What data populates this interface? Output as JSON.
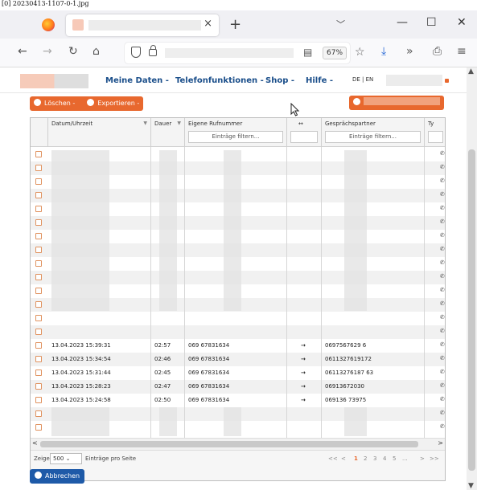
{
  "caption": "[0] 20230413-1107-0-1.jpg",
  "browser": {
    "tab_close": "×",
    "new_tab": "+",
    "tab_menu": "﹀",
    "win_min": "—",
    "win_max": "☐",
    "win_close": "✕",
    "nav_back": "←",
    "nav_forward": "→",
    "nav_reload": "↻",
    "nav_home": "⌂",
    "zoom": "67%",
    "toolbar_star": "☆",
    "toolbar_download": "⤓",
    "toolbar_more": "»",
    "toolbar_extensions": "⎙",
    "toolbar_menu": "≡"
  },
  "site": {
    "menu": [
      "Meine Daten -",
      "Telefonfunktionen -",
      "Shop -",
      "Hilfe -"
    ],
    "lang": "DE | EN",
    "actions": {
      "delete_label": "Löschen -",
      "export_label": "Exportieren -"
    }
  },
  "grid": {
    "columns": [
      "Datum/Uhrzeit",
      "Dauer",
      "Eigene Rufnummer",
      "↔",
      "Gesprächspartner",
      "Ty"
    ],
    "filter_placeholder": "Einträge filtern...",
    "rows": [
      {
        "datetime": "13.04.2023 15:39:31",
        "duration": "02:57",
        "own": "069 67831634",
        "partner": "0697567629 6"
      },
      {
        "datetime": "13.04.2023 15:34:54",
        "duration": "02:46",
        "own": "069 67831634",
        "partner": "0611327619172"
      },
      {
        "datetime": "13.04.2023 15:31:44",
        "duration": "02:45",
        "own": "069 67831634",
        "partner": "06113276187 63"
      },
      {
        "datetime": "13.04.2023 15:28:23",
        "duration": "02:47",
        "own": "069 67831634",
        "partner": "06913672030"
      },
      {
        "datetime": "13.04.2023 15:24:58",
        "duration": "02:50",
        "own": "069 67831634",
        "partner": "069136 73975"
      }
    ],
    "direction_glyph": "→",
    "type_glyph": "✆",
    "scroll_left": "<",
    "scroll_right": ">"
  },
  "pager": {
    "show_label": "Zeige",
    "page_size": "500",
    "per_page_label": "Einträge pro Seite",
    "first": "<<",
    "prev": "<",
    "pages": [
      "1",
      "2",
      "3",
      "4",
      "5"
    ],
    "ellipsis": "...",
    "next": ">",
    "last": ">>"
  },
  "cancel_label": "Abbrechen",
  "colors": {
    "accent_orange": "#e8682e",
    "brand_blue": "#1a4e8a",
    "button_blue": "#1e5aa8",
    "arrow_green": "#2ea043"
  }
}
